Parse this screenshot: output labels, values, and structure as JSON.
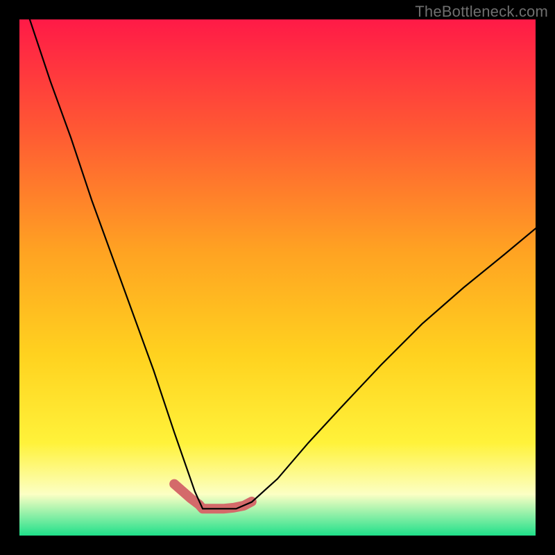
{
  "watermark": "TheBottleneck.com",
  "chart_data": {
    "type": "line",
    "title": "",
    "xlabel": "",
    "ylabel": "",
    "xlim": [
      0,
      1
    ],
    "ylim": [
      0,
      1
    ],
    "background_gradient": {
      "top": "#ff1a47",
      "mid_upper": "#ff7a2a",
      "mid": "#ffd21f",
      "mid_lower": "#ffff55",
      "near_bottom": "#fcffc4",
      "bottom": "#1fe08a"
    },
    "series": [
      {
        "name": "bottleneck-curve",
        "color": "#000000",
        "x": [
          0.02,
          0.06,
          0.1,
          0.14,
          0.18,
          0.22,
          0.26,
          0.3,
          0.34,
          0.355,
          0.38,
          0.42,
          0.45,
          0.5,
          0.56,
          0.62,
          0.7,
          0.78,
          0.86,
          0.94,
          1.0
        ],
        "y": [
          1.0,
          0.88,
          0.77,
          0.65,
          0.54,
          0.43,
          0.32,
          0.2,
          0.085,
          0.052,
          0.052,
          0.052,
          0.065,
          0.11,
          0.18,
          0.245,
          0.33,
          0.41,
          0.48,
          0.545,
          0.595
        ]
      },
      {
        "name": "near-minimum-highlight",
        "color": "#d46a6a",
        "stroke_width_px": 14,
        "x": [
          0.3,
          0.316,
          0.332,
          0.348,
          0.355,
          0.375,
          0.395,
          0.415,
          0.435,
          0.45
        ],
        "y": [
          0.1,
          0.086,
          0.072,
          0.06,
          0.052,
          0.052,
          0.052,
          0.054,
          0.058,
          0.066
        ]
      }
    ]
  }
}
